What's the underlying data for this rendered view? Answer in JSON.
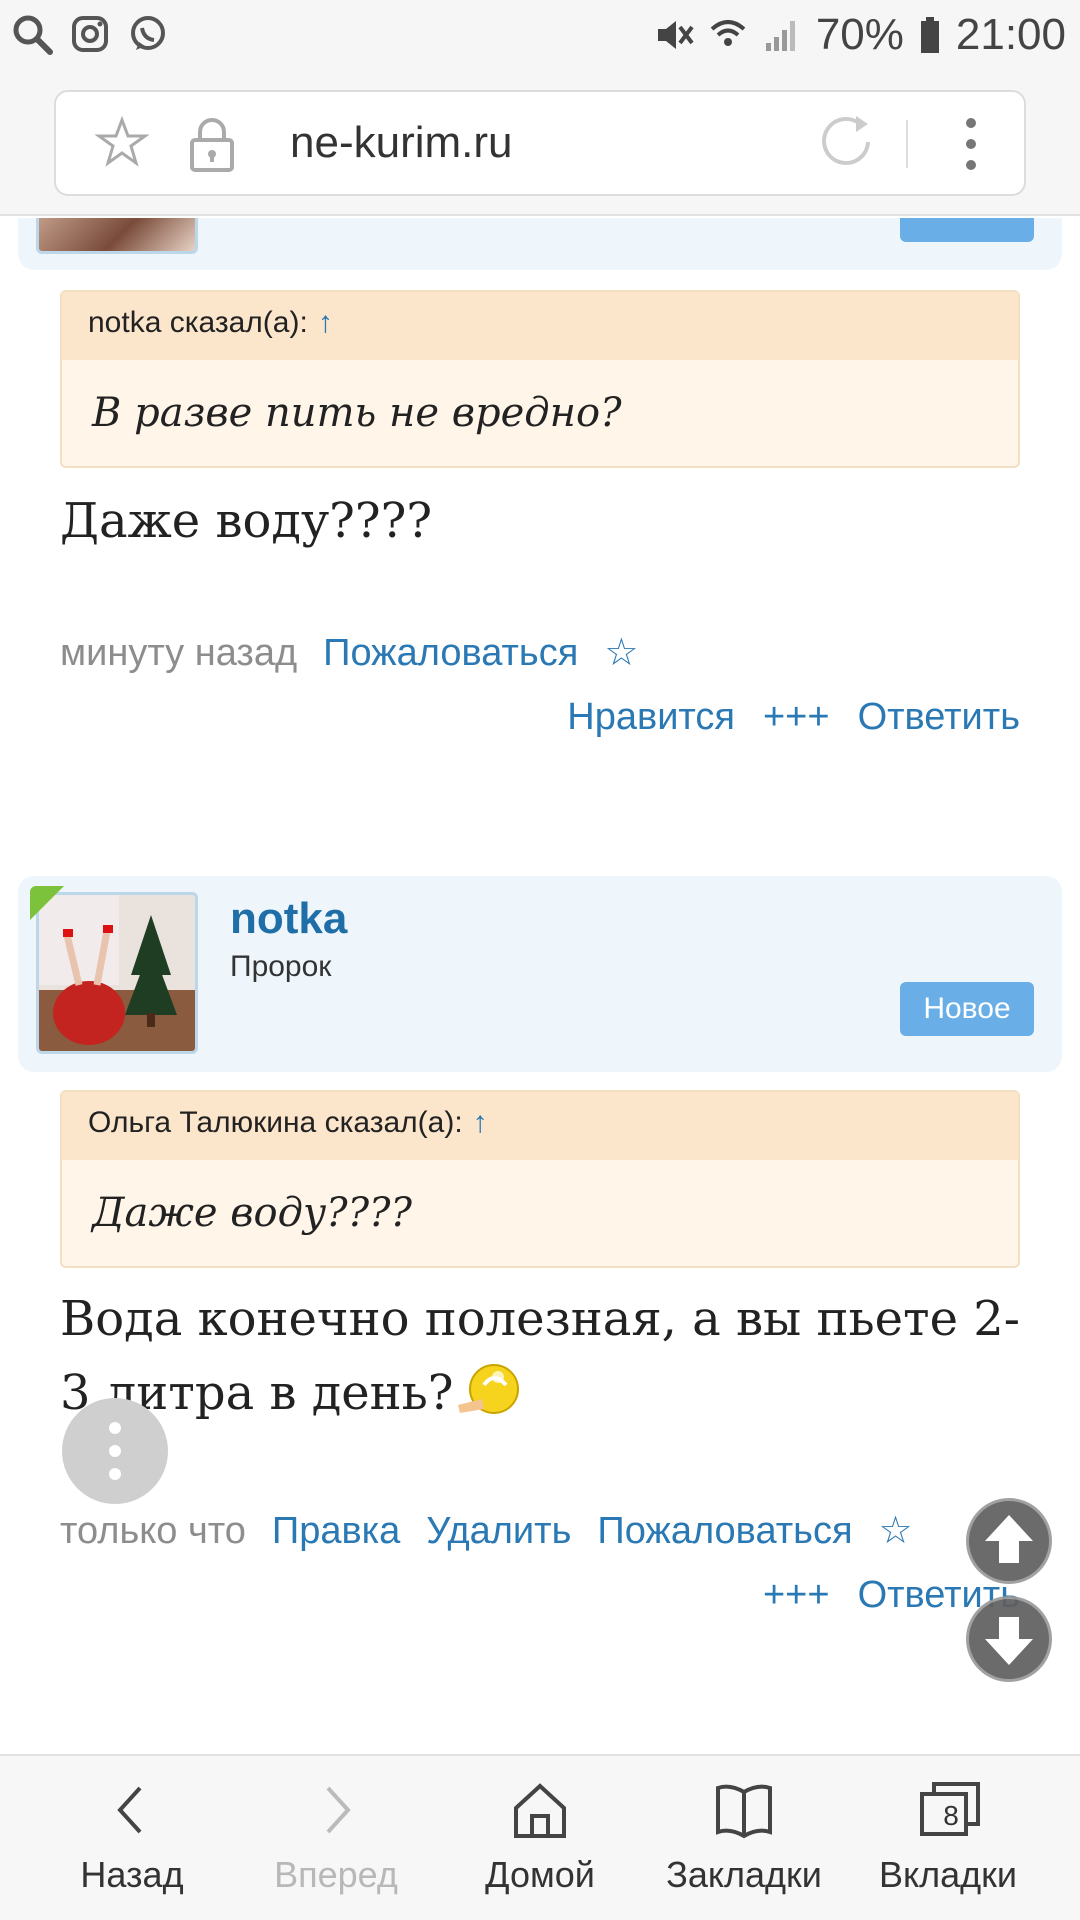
{
  "status_bar": {
    "battery": "70%",
    "time": "21:00"
  },
  "browser": {
    "url": "ne-kurim.ru"
  },
  "post1": {
    "quote_author": "notka сказал(а):",
    "quote_arrow": "↑",
    "quote_text": "В разве пить не вредно?",
    "message": "Даже воду????",
    "time": "минуту назад",
    "report": "Пожаловаться",
    "star": "☆",
    "like": "Нравится",
    "plus": "+++",
    "reply": "Ответить"
  },
  "post2": {
    "username": "notka",
    "rank": "Пророк",
    "badge": "Новое",
    "quote_author": "Ольга Талюкина сказал(а):",
    "quote_arrow": "↑",
    "quote_text": "Даже воду????",
    "message_line1": "Вода конечно полезная, а вы пьете 2-",
    "message_line2": "3 литра в день?",
    "time": "только что",
    "edit": "Правка",
    "delete": "Удалить",
    "report": "Пожаловаться",
    "star": "☆",
    "plus": "+++",
    "reply": "Ответить"
  },
  "bottom_nav": {
    "back": "Назад",
    "forward": "Вперед",
    "home": "Домой",
    "bookmarks": "Закладки",
    "tabs": "Вкладки",
    "tabs_count": "8"
  }
}
